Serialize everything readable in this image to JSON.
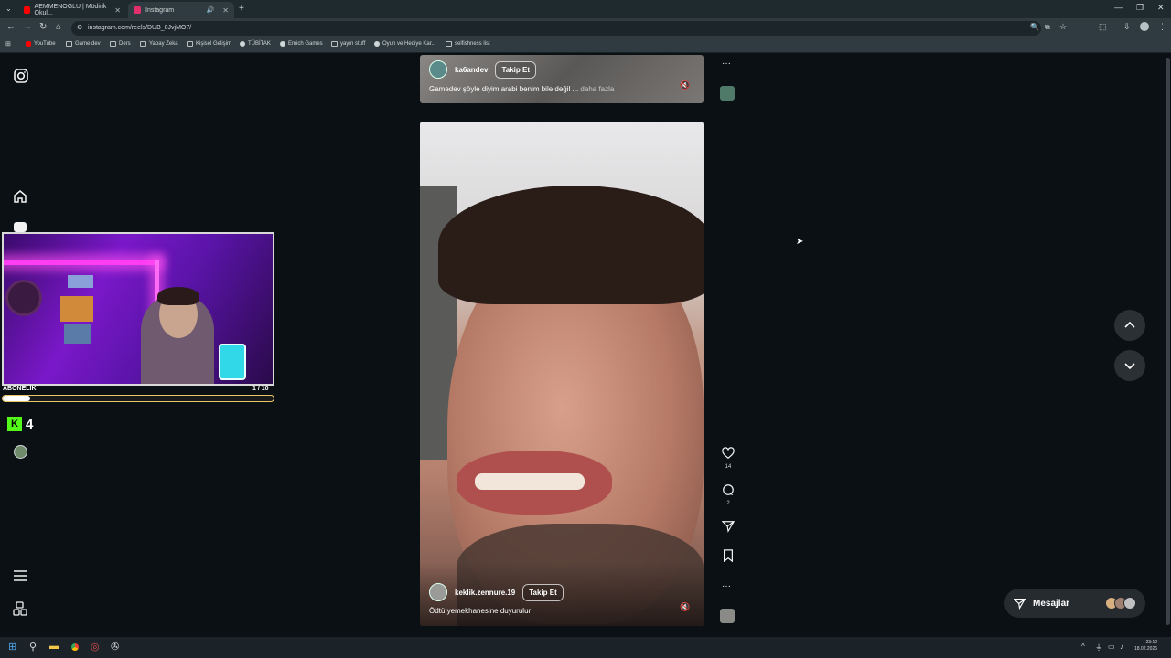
{
  "browser": {
    "tabs": [
      {
        "label": "AEMMENOGLU | Mödirik Okul...",
        "active": false,
        "favicon_color": "#ff0000"
      },
      {
        "label": "Instagram",
        "active": true,
        "favicon_color": "#e1306c"
      }
    ],
    "new_tab": "+",
    "url": "instagram.com/reels/DUB_0JvjMO7/",
    "bookmarks": [
      "YouTube",
      "Game dev",
      "Ders",
      "Yapay Zeka",
      "Kişisel Gelişim",
      "TÜBİTAK",
      "Emich Games",
      "yayın stuff",
      "Oyun ve Hediye Kar...",
      "selfishness list"
    ]
  },
  "webcam_overlay": {
    "label": "ABONELİK",
    "count": "1 / 10",
    "progress": 0.1
  },
  "kick": {
    "logo_letter": "K",
    "count": "4"
  },
  "reels": [
    {
      "author": "ka6andev",
      "follow_label": "Takip Et",
      "caption": "Gamedev şöyle diyim arabi benim bile değil ...",
      "more_label": "daha fazla"
    },
    {
      "author": "keklik.zennure.19",
      "follow_label": "Takip Et",
      "caption": "Ödtü yemekhanesine duyurulur",
      "likes": "14",
      "comments": "2"
    }
  ],
  "actions": {
    "more": "···"
  },
  "messages": {
    "label": "Mesajlar"
  },
  "taskbar": {
    "time": "23:12",
    "date": "18.02.2026"
  }
}
